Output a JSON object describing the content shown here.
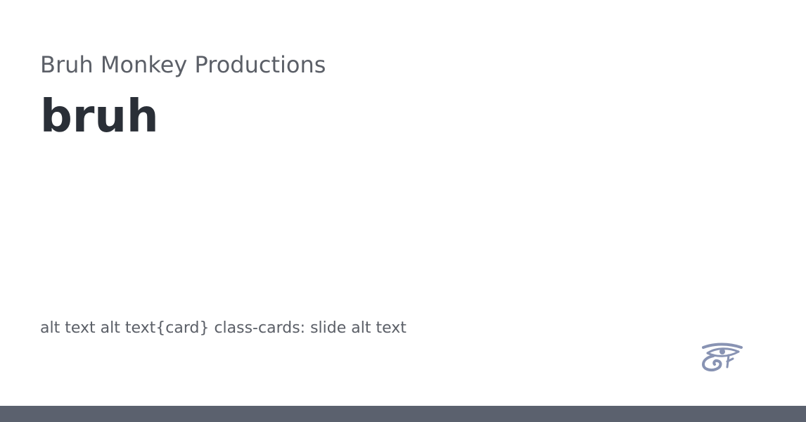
{
  "card": {
    "site_name": "Bruh Monkey Productions",
    "title": "bruh",
    "description": "alt text alt text{card} class-cards: slide alt text",
    "logo_icon": "eye-of-horus-icon"
  },
  "colors": {
    "background": "#ffffff",
    "site_name_text": "#5b5f67",
    "title_text": "#2a2f37",
    "description_text": "#5b5f67",
    "logo": "#8893b3",
    "footer_bar": "#5b616e"
  }
}
